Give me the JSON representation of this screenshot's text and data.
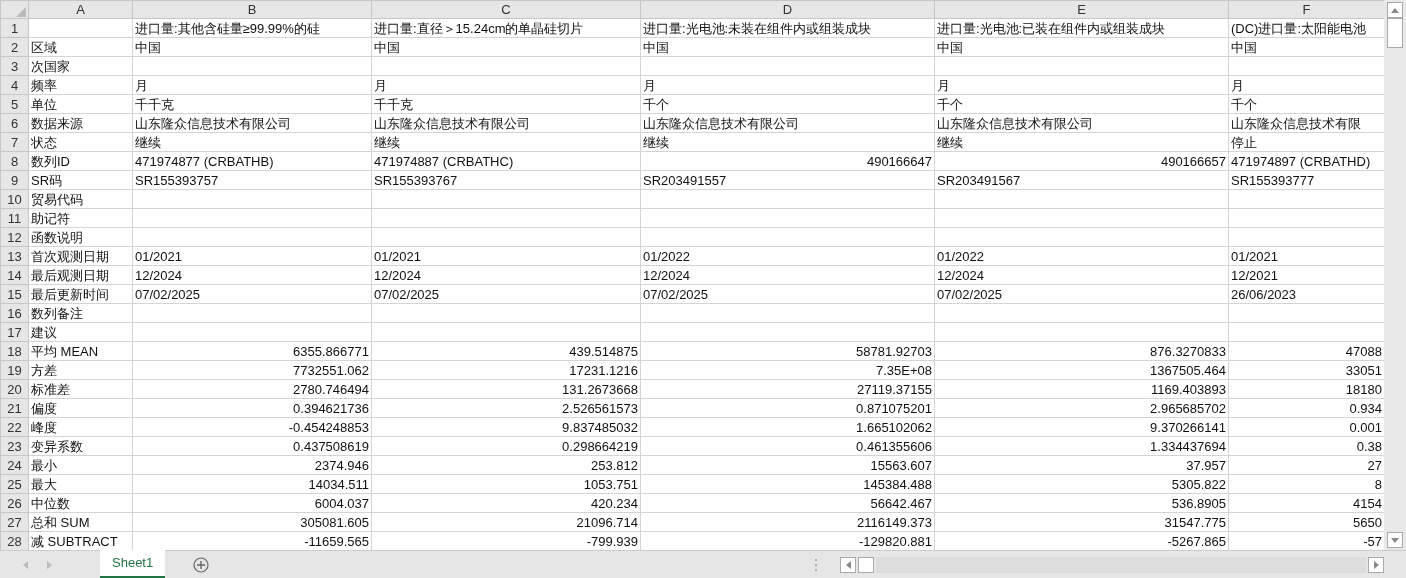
{
  "columns": [
    "A",
    "B",
    "C",
    "D",
    "E",
    "F"
  ],
  "rows": [
    {
      "number": "1",
      "cells": [
        "",
        "进口量:其他含硅量≥99.99%的硅",
        "进口量:直径＞15.24cm的单晶硅切片",
        "进口量:光电池:未装在组件内或组装成块",
        "进口量:光电池:已装在组件内或组装成块",
        "(DC)进口量:太阳能电池"
      ]
    },
    {
      "number": "2",
      "cells": [
        "区域",
        "中国",
        "中国",
        "中国",
        "中国",
        "中国"
      ]
    },
    {
      "number": "3",
      "cells": [
        "次国家",
        "",
        "",
        "",
        "",
        ""
      ]
    },
    {
      "number": "4",
      "cells": [
        "频率",
        "月",
        "月",
        "月",
        "月",
        "月"
      ]
    },
    {
      "number": "5",
      "cells": [
        "单位",
        "千千克",
        "千千克",
        "千个",
        "千个",
        "千个"
      ]
    },
    {
      "number": "6",
      "cells": [
        "数据来源",
        "山东隆众信息技术有限公司",
        "山东隆众信息技术有限公司",
        "山东隆众信息技术有限公司",
        "山东隆众信息技术有限公司",
        "山东隆众信息技术有限"
      ]
    },
    {
      "number": "7",
      "cells": [
        "状态",
        "继续",
        "继续",
        "继续",
        "继续",
        "停止"
      ]
    },
    {
      "number": "8",
      "cells": [
        "数列ID",
        "471974877 (CRBATHB)",
        "471974887 (CRBATHC)",
        {
          "text": "490166647",
          "kind": "number"
        },
        {
          "text": "490166657",
          "kind": "number"
        },
        "471974897 (CRBATHD)"
      ]
    },
    {
      "number": "9",
      "cells": [
        "SR码",
        "SR155393757",
        "SR155393767",
        "SR203491557",
        "SR203491567",
        "SR155393777"
      ]
    },
    {
      "number": "10",
      "cells": [
        "贸易代码",
        "",
        "",
        "",
        "",
        ""
      ]
    },
    {
      "number": "11",
      "cells": [
        "助记符",
        "",
        "",
        "",
        "",
        ""
      ]
    },
    {
      "number": "12",
      "cells": [
        "函数说明",
        "",
        "",
        "",
        "",
        ""
      ]
    },
    {
      "number": "13",
      "cells": [
        "首次观测日期",
        "01/2021",
        "01/2021",
        "01/2022",
        "01/2022",
        "01/2021"
      ]
    },
    {
      "number": "14",
      "cells": [
        "最后观测日期",
        "12/2024",
        "12/2024",
        "12/2024",
        "12/2024",
        "12/2021"
      ]
    },
    {
      "number": "15",
      "cells": [
        "最后更新时间",
        "07/02/2025",
        "07/02/2025",
        "07/02/2025",
        "07/02/2025",
        "26/06/2023"
      ]
    },
    {
      "number": "16",
      "cells": [
        "数列备注",
        "",
        "",
        "",
        "",
        ""
      ]
    },
    {
      "number": "17",
      "cells": [
        "建议",
        "",
        "",
        "",
        "",
        ""
      ]
    },
    {
      "number": "18",
      "kind": "numeric",
      "cells": [
        "平均 MEAN",
        "6355.866771",
        "439.514875",
        "58781.92703",
        "876.3270833",
        "47088"
      ]
    },
    {
      "number": "19",
      "kind": "numeric",
      "cells": [
        "方差",
        "7732551.062",
        "17231.1216",
        "7.35E+08",
        "1367505.464",
        "33051"
      ]
    },
    {
      "number": "20",
      "kind": "numeric",
      "cells": [
        "标准差",
        "2780.746494",
        "131.2673668",
        "27119.37155",
        "1169.403893",
        "18180"
      ]
    },
    {
      "number": "21",
      "kind": "numeric",
      "cells": [
        "偏度",
        "0.394621736",
        "2.526561573",
        "0.871075201",
        "2.965685702",
        "0.934"
      ]
    },
    {
      "number": "22",
      "kind": "numeric",
      "cells": [
        "峰度",
        "-0.454248853",
        "9.837485032",
        "1.665102062",
        "9.370266141",
        "0.001"
      ]
    },
    {
      "number": "23",
      "kind": "numeric",
      "cells": [
        "变异系数",
        "0.437508619",
        "0.298664219",
        "0.461355606",
        "1.334437694",
        "0.38"
      ]
    },
    {
      "number": "24",
      "kind": "numeric",
      "cells": [
        "最小",
        "2374.946",
        "253.812",
        "15563.607",
        "37.957",
        "27"
      ]
    },
    {
      "number": "25",
      "kind": "numeric",
      "cells": [
        "最大",
        "14034.511",
        "1053.751",
        "145384.488",
        "5305.822",
        "8"
      ]
    },
    {
      "number": "26",
      "kind": "numeric",
      "cells": [
        "中位数",
        "6004.037",
        "420.234",
        "56642.467",
        "536.8905",
        "4154"
      ]
    },
    {
      "number": "27",
      "kind": "numeric",
      "cells": [
        "总和 SUM",
        "305081.605",
        "21096.714",
        "2116149.373",
        "31547.775",
        "5650"
      ]
    },
    {
      "number": "28",
      "kind": "numeric",
      "cells": [
        "减 SUBTRACT",
        "-11659.565",
        "-799.939",
        "-129820.881",
        "-5267.865",
        "-57"
      ]
    }
  ],
  "sheets": [
    {
      "label": "Sheet1",
      "selected": true
    }
  ]
}
